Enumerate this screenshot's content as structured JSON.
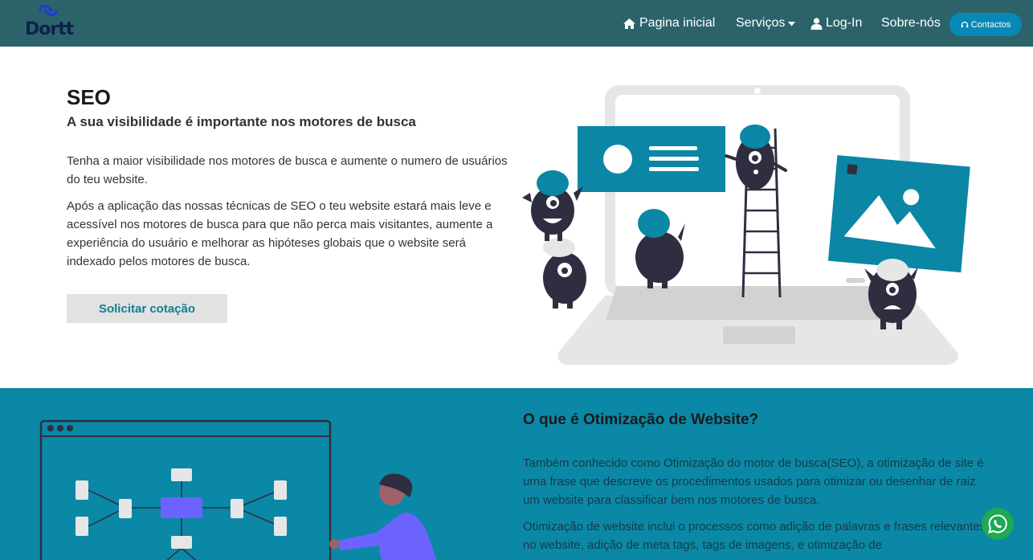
{
  "brand": {
    "name": "Dortt"
  },
  "nav": {
    "home": "Pagina inicial",
    "services": "Serviços",
    "login": "Log-In",
    "about": "Sobre-nós",
    "contacts": "Contactos"
  },
  "hero": {
    "title": "SEO",
    "subtitle": "A sua visibilidade é importante nos motores de busca",
    "p1": "Tenha a maior visibilidade nos motores de busca e aumente o numero de usuários do teu website.",
    "p2": "Após a aplicação das nossas técnicas de SEO o teu website estará mais leve e acessível nos motores de busca para que não perca mais visitantes, aumente a experiência do usuário e melhorar as hipóteses globais que o website será indexado pelos motores de busca.",
    "cta": "Solicitar cotação"
  },
  "section2": {
    "title": "O que é Otimização de Website?",
    "p1": "Também conhecido como Otimização do motor de busca(SEO), a otimização de site é uma frase que descreve os procedimentos usados para otimizar ou desenhar de raiz um website para classificar bem nos motores de busca.",
    "p2": "Otimização de website inclui o processos como adição de palavras e frases relevantes no website, adição de meta tags, tags de imagens, e otimização de"
  },
  "colors": {
    "navbar": "#2c636b",
    "accent": "#0789b7",
    "section_bg": "#0b88a6",
    "whatsapp": "#1fa855"
  },
  "icons": {
    "home": "home-icon",
    "caret": "caret-down-icon",
    "user": "user-icon",
    "contacts": "headset-icon",
    "whatsapp": "whatsapp-icon"
  }
}
